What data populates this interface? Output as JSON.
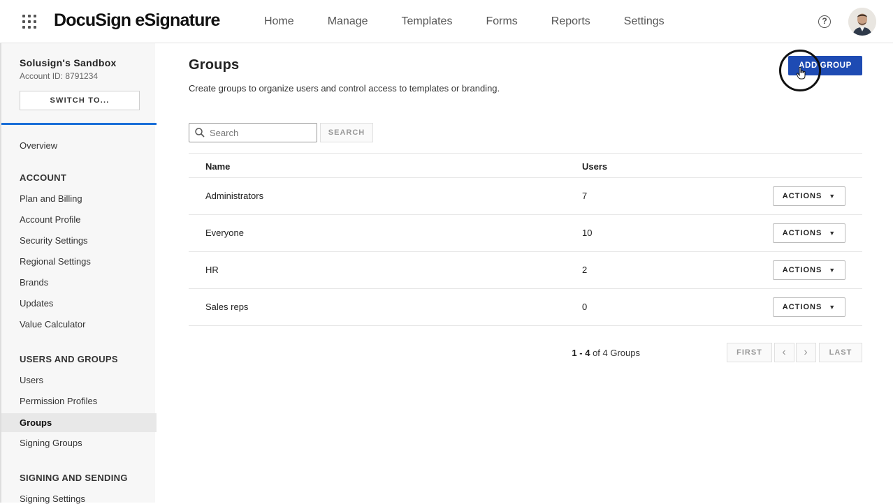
{
  "header": {
    "logo": "DocuSign eSignature",
    "nav": [
      "Home",
      "Manage",
      "Templates",
      "Forms",
      "Reports",
      "Settings"
    ],
    "help_label": "?"
  },
  "sidebar": {
    "account_name": "Solusign's Sandbox",
    "account_id": "Account ID: 8791234",
    "switch_label": "SWITCH TO...",
    "overview": "Overview",
    "section_account": "ACCOUNT",
    "account_items": [
      "Plan and Billing",
      "Account Profile",
      "Security Settings",
      "Regional Settings",
      "Brands",
      "Updates",
      "Value Calculator"
    ],
    "section_users": "USERS AND GROUPS",
    "users_items": [
      "Users",
      "Permission Profiles",
      "Groups",
      "Signing Groups"
    ],
    "section_signing": "SIGNING AND SENDING",
    "signing_items": [
      "Signing Settings"
    ],
    "active_item": "Groups"
  },
  "main": {
    "title": "Groups",
    "description": "Create groups to organize users and control access to templates or branding.",
    "add_button": "ADD GROUP",
    "search_placeholder": "Search",
    "search_button": "SEARCH",
    "columns": {
      "name": "Name",
      "users": "Users"
    },
    "rows": [
      {
        "name": "Administrators",
        "users": "7",
        "action": "ACTIONS"
      },
      {
        "name": "Everyone",
        "users": "10",
        "action": "ACTIONS"
      },
      {
        "name": "HR",
        "users": "2",
        "action": "ACTIONS"
      },
      {
        "name": "Sales reps",
        "users": "0",
        "action": "ACTIONS"
      }
    ],
    "pager": {
      "range": "1 - 4",
      "of_text": "of 4 Groups",
      "first": "FIRST",
      "prev": "‹",
      "next": "›",
      "last": "LAST"
    }
  },
  "colors": {
    "accent": "#1a6ed8",
    "primary_button": "#1e4bb3"
  }
}
